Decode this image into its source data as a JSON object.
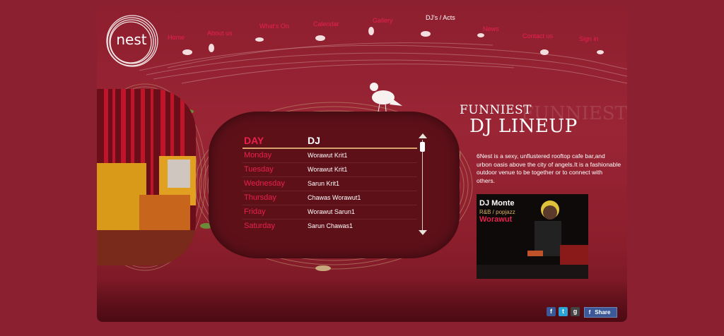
{
  "brand": {
    "logo_text": "nest"
  },
  "nav": {
    "items": [
      {
        "label": "Home"
      },
      {
        "label": "About us"
      },
      {
        "label": "What's On"
      },
      {
        "label": "Calendar"
      },
      {
        "label": "Gallery"
      },
      {
        "label": "DJ's / Acts",
        "active": true
      },
      {
        "label": "News"
      },
      {
        "label": "Contact us"
      },
      {
        "label": "Sign in"
      }
    ]
  },
  "schedule": {
    "day_header": "DAY",
    "dj_header": "DJ",
    "rows": [
      {
        "day": "Monday",
        "dj": "Worawut Krit1"
      },
      {
        "day": "Tuesday",
        "dj": "Worawut Krit1"
      },
      {
        "day": "Wednesday",
        "dj": "Sarun Krit1"
      },
      {
        "day": "Thursday",
        "dj": "Chawas Worawut1"
      },
      {
        "day": "Friday",
        "dj": "Worawut Sarun1"
      },
      {
        "day": "Saturday",
        "dj": "Sarun Chawas1"
      }
    ]
  },
  "headline": {
    "line1": "FUNNIEST",
    "line2": "DJ LINEUP"
  },
  "description": "6Nest is a sexy, unflustered rooftop cafe bar,and urbon oasis above the city of angels.It is a fashionable outdoor venue to be together or to connect with others.",
  "promo": {
    "name": "DJ Monte",
    "genre": "R&B / popjazz",
    "sub": "Worawut"
  },
  "social": {
    "share_label": "Share"
  },
  "colors": {
    "accent": "#e8214c",
    "background": "#8b2130",
    "panel": "#5e1019"
  }
}
